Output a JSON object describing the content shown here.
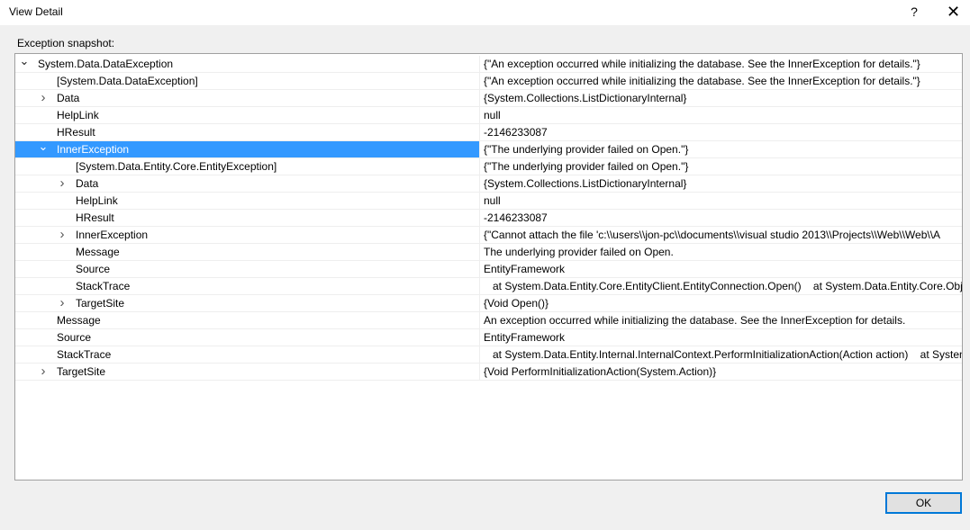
{
  "window": {
    "title": "View Detail",
    "help_glyph": "?",
    "close_glyph": "✕"
  },
  "snapshot_label": "Exception snapshot:",
  "rows": [
    {
      "name": "System.Data.DataException",
      "value": "{\"An exception occurred while initializing the database. See the InnerException for details.\"}",
      "depth": 0,
      "expander": "expanded",
      "selected": false
    },
    {
      "name": "[System.Data.DataException]",
      "value": "{\"An exception occurred while initializing the database. See the InnerException for details.\"}",
      "depth": 1,
      "expander": "none",
      "selected": false
    },
    {
      "name": "Data",
      "value": "{System.Collections.ListDictionaryInternal}",
      "depth": 1,
      "expander": "collapsed",
      "selected": false
    },
    {
      "name": "HelpLink",
      "value": "null",
      "depth": 1,
      "expander": "none",
      "selected": false
    },
    {
      "name": "HResult",
      "value": "-2146233087",
      "depth": 1,
      "expander": "none",
      "selected": false
    },
    {
      "name": "InnerException",
      "value": "{\"The underlying provider failed on Open.\"}",
      "depth": 1,
      "expander": "expanded",
      "selected": true
    },
    {
      "name": "[System.Data.Entity.Core.EntityException]",
      "value": "{\"The underlying provider failed on Open.\"}",
      "depth": 2,
      "expander": "none",
      "selected": false
    },
    {
      "name": "Data",
      "value": "{System.Collections.ListDictionaryInternal}",
      "depth": 2,
      "expander": "collapsed",
      "selected": false
    },
    {
      "name": "HelpLink",
      "value": "null",
      "depth": 2,
      "expander": "none",
      "selected": false
    },
    {
      "name": "HResult",
      "value": "-2146233087",
      "depth": 2,
      "expander": "none",
      "selected": false
    },
    {
      "name": "InnerException",
      "value": "{\"Cannot attach the file 'c:\\\\users\\\\jon-pc\\\\documents\\\\visual studio 2013\\\\Projects\\\\Web\\\\Web\\\\A",
      "depth": 2,
      "expander": "collapsed",
      "selected": false
    },
    {
      "name": "Message",
      "value": "The underlying provider failed on Open.",
      "depth": 2,
      "expander": "none",
      "selected": false
    },
    {
      "name": "Source",
      "value": "EntityFramework",
      "depth": 2,
      "expander": "none",
      "selected": false
    },
    {
      "name": "StackTrace",
      "value": "   at System.Data.Entity.Core.EntityClient.EntityConnection.Open()    at System.Data.Entity.Core.Object",
      "depth": 2,
      "expander": "none",
      "selected": false
    },
    {
      "name": "TargetSite",
      "value": "{Void Open()}",
      "depth": 2,
      "expander": "collapsed",
      "selected": false
    },
    {
      "name": "Message",
      "value": "An exception occurred while initializing the database. See the InnerException for details.",
      "depth": 1,
      "expander": "none",
      "selected": false
    },
    {
      "name": "Source",
      "value": "EntityFramework",
      "depth": 1,
      "expander": "none",
      "selected": false
    },
    {
      "name": "StackTrace",
      "value": "   at System.Data.Entity.Internal.InternalContext.PerformInitializationAction(Action action)    at System",
      "depth": 1,
      "expander": "none",
      "selected": false
    },
    {
      "name": "TargetSite",
      "value": "{Void PerformInitializationAction(System.Action)}",
      "depth": 1,
      "expander": "collapsed",
      "selected": false
    }
  ],
  "ok_label": "OK"
}
